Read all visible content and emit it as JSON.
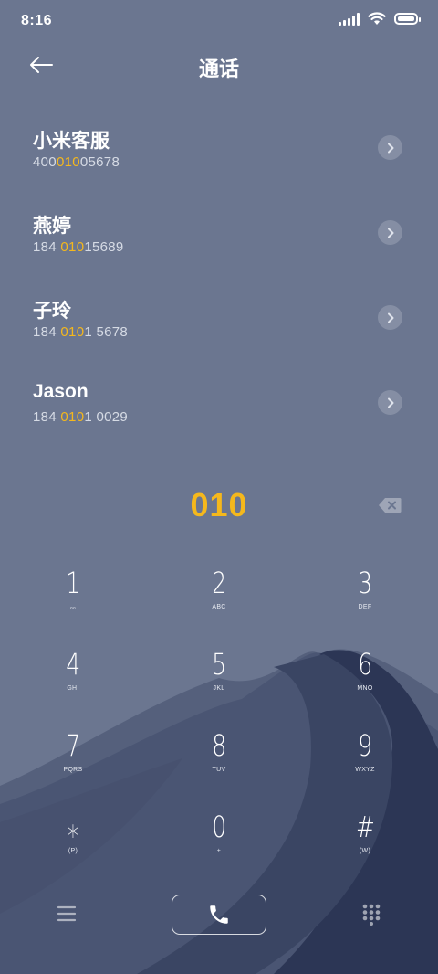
{
  "status_bar": {
    "time": "8:16",
    "icons": [
      "signal-icon",
      "wifi-icon",
      "battery-icon"
    ],
    "battery_level": 1.0
  },
  "header": {
    "title": "通话",
    "back_icon": "arrow-left-icon"
  },
  "contacts": [
    {
      "name": "小米客服",
      "number_parts": [
        "400",
        "010",
        "05678"
      ]
    },
    {
      "name": "燕婷",
      "number_parts": [
        "184 ",
        "010",
        "15689"
      ]
    },
    {
      "name": "子玲",
      "number_parts": [
        "184 ",
        "010",
        "1 5678"
      ]
    },
    {
      "name": "Jason",
      "number_parts": [
        "184 ",
        "010",
        "1 0029"
      ]
    }
  ],
  "dialer": {
    "dialed_number": "010",
    "backspace_icon": "backspace-icon"
  },
  "keypad": {
    "rows": [
      [
        {
          "digit": "1",
          "sub": "ₒₒ"
        },
        {
          "digit": "2",
          "sub": "ABC"
        },
        {
          "digit": "3",
          "sub": "DEF"
        }
      ],
      [
        {
          "digit": "4",
          "sub": "GHI"
        },
        {
          "digit": "5",
          "sub": "JKL"
        },
        {
          "digit": "6",
          "sub": "MNO"
        }
      ],
      [
        {
          "digit": "7",
          "sub": "PQRS"
        },
        {
          "digit": "8",
          "sub": "TUV"
        },
        {
          "digit": "9",
          "sub": "WXYZ"
        }
      ],
      [
        {
          "digit": "⁎",
          "sub": "(P)"
        },
        {
          "digit": "0",
          "sub": "+"
        },
        {
          "digit": "#",
          "sub": "(W)"
        }
      ]
    ]
  },
  "bottom_bar": {
    "menu_icon": "menu-icon",
    "call_icon": "phone-icon",
    "dialpad_icon": "dialpad-icon"
  },
  "colors": {
    "background": "#6b7690",
    "highlight": "#f5b81c",
    "text": "#ffffff"
  }
}
